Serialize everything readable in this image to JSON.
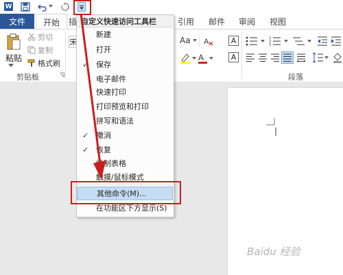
{
  "quick_access": {
    "app_icon": "W",
    "icons": [
      "word-icon",
      "save-icon",
      "undo-icon",
      "redo-icon",
      "customize-dropdown-icon"
    ]
  },
  "tabs": {
    "file": "文件",
    "home": "开始",
    "home_partial": "插",
    "references": "引用",
    "mailings": "邮件",
    "review": "审阅",
    "view": "视图"
  },
  "clipboard": {
    "paste": "粘贴",
    "cut": "剪切",
    "copy": "复制",
    "format_painter": "格式刷",
    "group_label": "剪贴板"
  },
  "font_box_partial": "宋",
  "paragraph": {
    "group_label": "段落"
  },
  "menu": {
    "title": "自定义快速访问工具栏",
    "items": [
      {
        "label": "新建",
        "checked": false
      },
      {
        "label": "打开",
        "checked": false
      },
      {
        "label": "保存",
        "checked": true
      },
      {
        "label": "电子邮件",
        "checked": false
      },
      {
        "label": "快速打印",
        "checked": false
      },
      {
        "label": "打印预览和打印",
        "checked": false
      },
      {
        "label": "拼写和语法",
        "checked": false
      },
      {
        "label": "撤消",
        "checked": true
      },
      {
        "label": "恢复",
        "checked": true
      },
      {
        "label": "绘制表格",
        "checked": false
      },
      {
        "label": "触摸/鼠标模式",
        "checked": false
      },
      {
        "label": "其他命令(M)...",
        "checked": false,
        "highlighted": true
      },
      {
        "label": "在功能区下方显示(S)",
        "checked": false
      }
    ]
  },
  "watermark": "Baidu 经验",
  "colors": {
    "accent": "#2b579a",
    "annotation": "#cc1d1d",
    "highlight": "#c5dcf3"
  }
}
